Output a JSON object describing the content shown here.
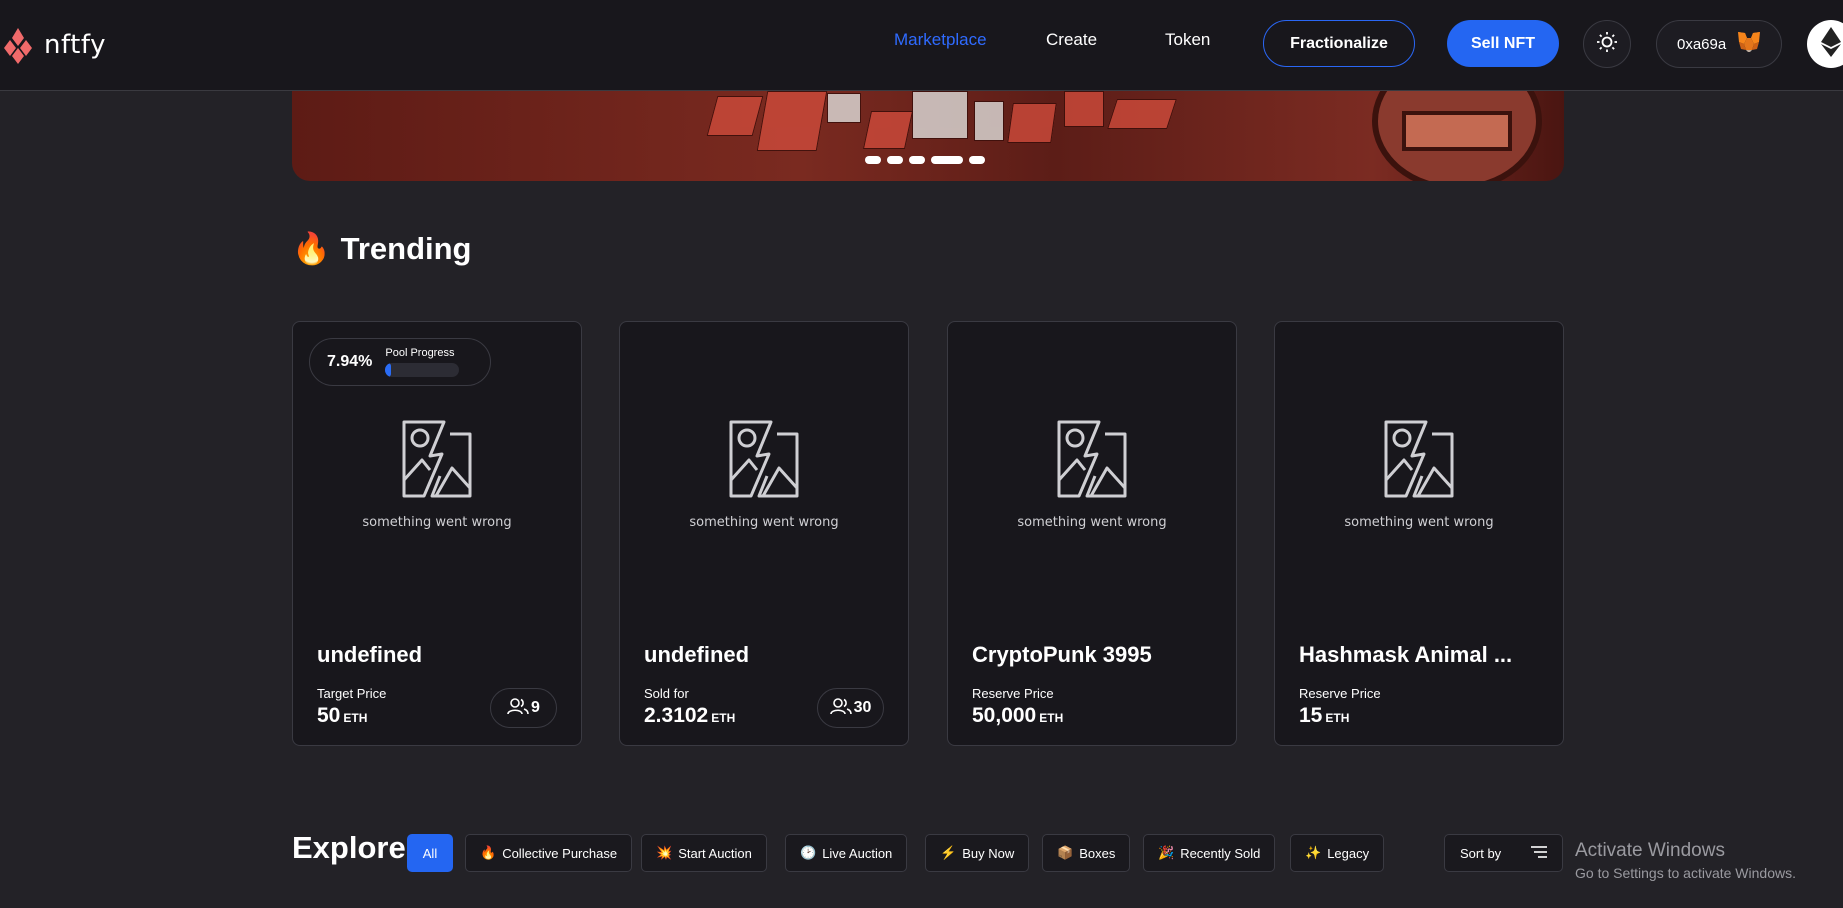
{
  "brand": {
    "name": "nftfy"
  },
  "nav": {
    "marketplace": "Marketplace",
    "create": "Create",
    "token": "Token"
  },
  "actions": {
    "fractionalize": "Fractionalize",
    "sell": "Sell NFT"
  },
  "wallet": {
    "address": "0xa69a"
  },
  "trending": {
    "emoji": "🔥",
    "title": "Trending"
  },
  "cards": [
    {
      "pool_pct": "7.94%",
      "pool_label": "Pool Progress",
      "pool_progress": 0.0794,
      "error": "something went wrong",
      "title": "undefined",
      "price_label": "Target Price",
      "price": "50",
      "unit": "ETH",
      "members": "9"
    },
    {
      "error": "something went wrong",
      "title": "undefined",
      "price_label": "Sold for",
      "price": "2.3102",
      "unit": "ETH",
      "members": "30"
    },
    {
      "error": "something went wrong",
      "title": "CryptoPunk 3995",
      "price_label": "Reserve Price",
      "price": "50,000",
      "unit": "ETH"
    },
    {
      "error": "something went wrong",
      "title": "Hashmask Animal ...",
      "price_label": "Reserve Price",
      "price": "15",
      "unit": "ETH"
    }
  ],
  "explore": {
    "title": "Explore",
    "filters": [
      {
        "icon": "",
        "label": "All"
      },
      {
        "icon": "🔥",
        "label": "Collective Purchase"
      },
      {
        "icon": "💥",
        "label": "Start Auction"
      },
      {
        "icon": "🕑",
        "label": "Live Auction"
      },
      {
        "icon": "⚡",
        "label": "Buy Now"
      },
      {
        "icon": "📦",
        "label": "Boxes"
      },
      {
        "icon": "🎉",
        "label": "Recently Sold"
      },
      {
        "icon": "✨",
        "label": "Legacy"
      }
    ],
    "sort_label": "Sort by"
  },
  "os_watermark": {
    "line1": "Activate Windows",
    "line2": "Go to Settings to activate Windows."
  },
  "colors": {
    "accent": "#2466f2",
    "background": "#232227",
    "surface": "#18171c"
  }
}
